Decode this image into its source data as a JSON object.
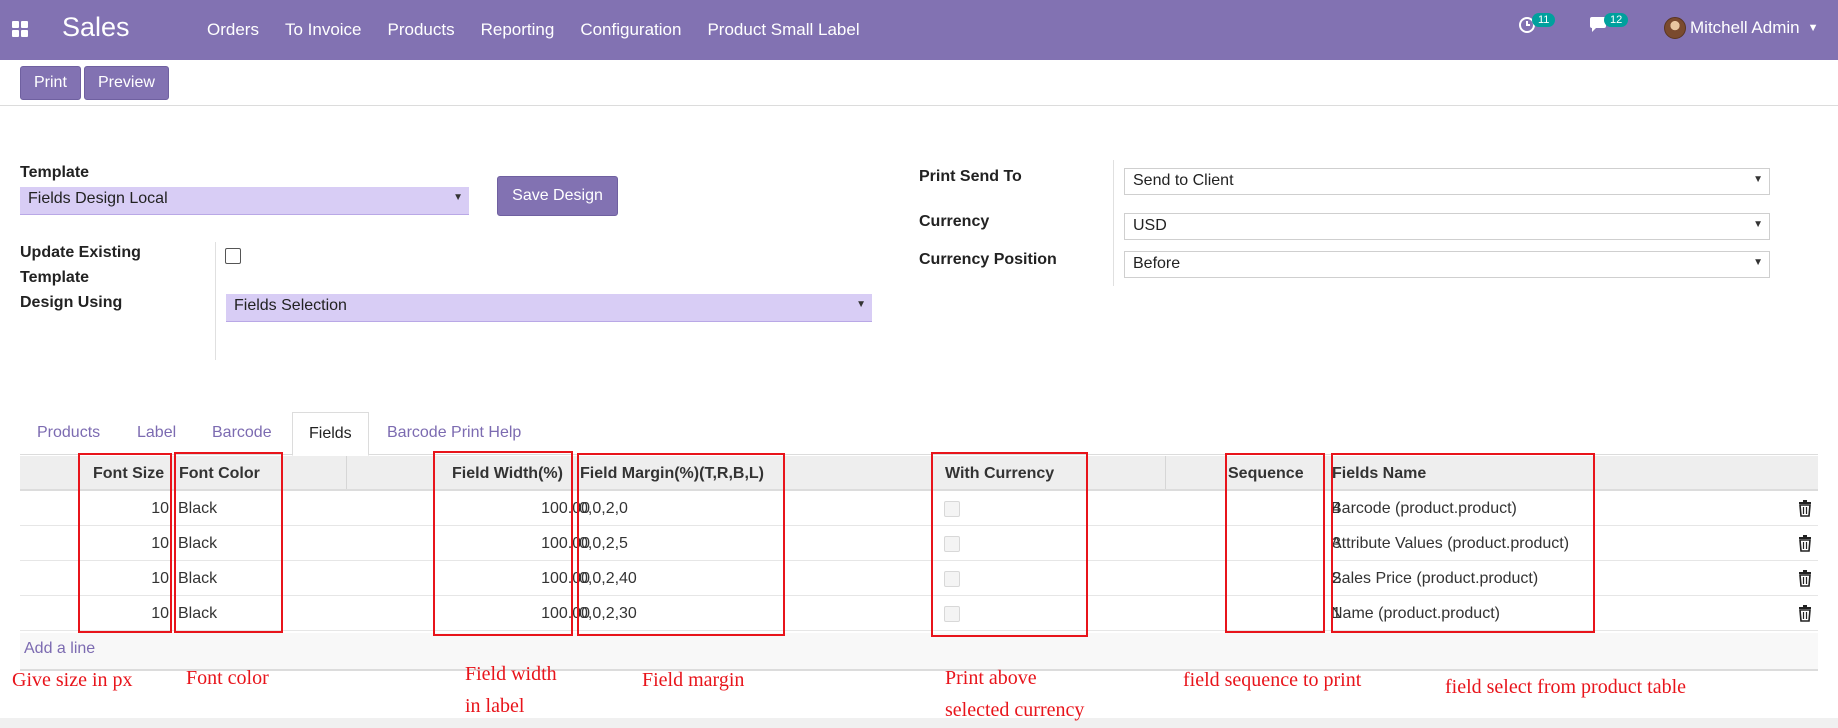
{
  "navbar": {
    "brand": "Sales",
    "menu": [
      "Orders",
      "To Invoice",
      "Products",
      "Reporting",
      "Configuration",
      "Product Small Label"
    ],
    "activity_count": "11",
    "message_count": "12",
    "user_name": "Mitchell Admin",
    "bg_color": "#8272b2"
  },
  "control": {
    "print_label": "Print",
    "preview_label": "Preview"
  },
  "form": {
    "template_label": "Template",
    "template_value": "Fields Design Local",
    "save_design_label": "Save Design",
    "update_existing_label_1": "Update Existing",
    "update_existing_label_2": "Template",
    "update_existing_checked": false,
    "design_using_label": "Design Using",
    "design_using_value": "Fields Selection",
    "print_send_to_label": "Print Send To",
    "print_send_to_value": "Send to Client",
    "currency_label": "Currency",
    "currency_value": "USD",
    "currency_position_label": "Currency Position",
    "currency_position_value": "Before"
  },
  "tabs": [
    "Products",
    "Label",
    "Barcode",
    "Fields",
    "Barcode Print Help"
  ],
  "active_tab": "Fields",
  "table": {
    "headers": {
      "font_size": "Font Size",
      "font_color": "Font Color",
      "field_width": "Field Width(%)",
      "field_margin": "Field Margin(%)(T,R,B,L)",
      "with_currency": "With Currency",
      "sequence": "Sequence",
      "fields_name": "Fields Name"
    },
    "rows": [
      {
        "font_size": "10",
        "font_color": "Black",
        "field_width": "100.00",
        "field_margin": "0,0,2,0",
        "with_currency": false,
        "sequence": "4",
        "fields_name": "Barcode (product.product)"
      },
      {
        "font_size": "10",
        "font_color": "Black",
        "field_width": "100.00",
        "field_margin": "0,0,2,5",
        "with_currency": false,
        "sequence": "3",
        "fields_name": "Attribute Values (product.product)"
      },
      {
        "font_size": "10",
        "font_color": "Black",
        "field_width": "100.00",
        "field_margin": "0,0,2,40",
        "with_currency": false,
        "sequence": "2",
        "fields_name": "Sales Price (product.product)"
      },
      {
        "font_size": "10",
        "font_color": "Black",
        "field_width": "100.00",
        "field_margin": "0,0,2,30",
        "with_currency": false,
        "sequence": "1",
        "fields_name": "Name (product.product)"
      }
    ],
    "add_line_label": "Add a line"
  },
  "annotations": {
    "color": "#e8141b",
    "font_size_note": "Give size in px",
    "font_color_note": "Font color",
    "field_width_note_1": "Field width",
    "field_width_note_2": "in label",
    "field_margin_note": "Field margin",
    "with_currency_note_1": "Print above",
    "with_currency_note_2": "selected currency",
    "sequence_note": "field sequence to print",
    "fields_name_note": "field select from product table"
  },
  "icons": {
    "apps": "apps-grid-icon",
    "activity": "clock-activity-icon",
    "messages": "chat-bubble-icon",
    "dropdown": "chevron-down-icon",
    "delete": "trash-icon"
  }
}
